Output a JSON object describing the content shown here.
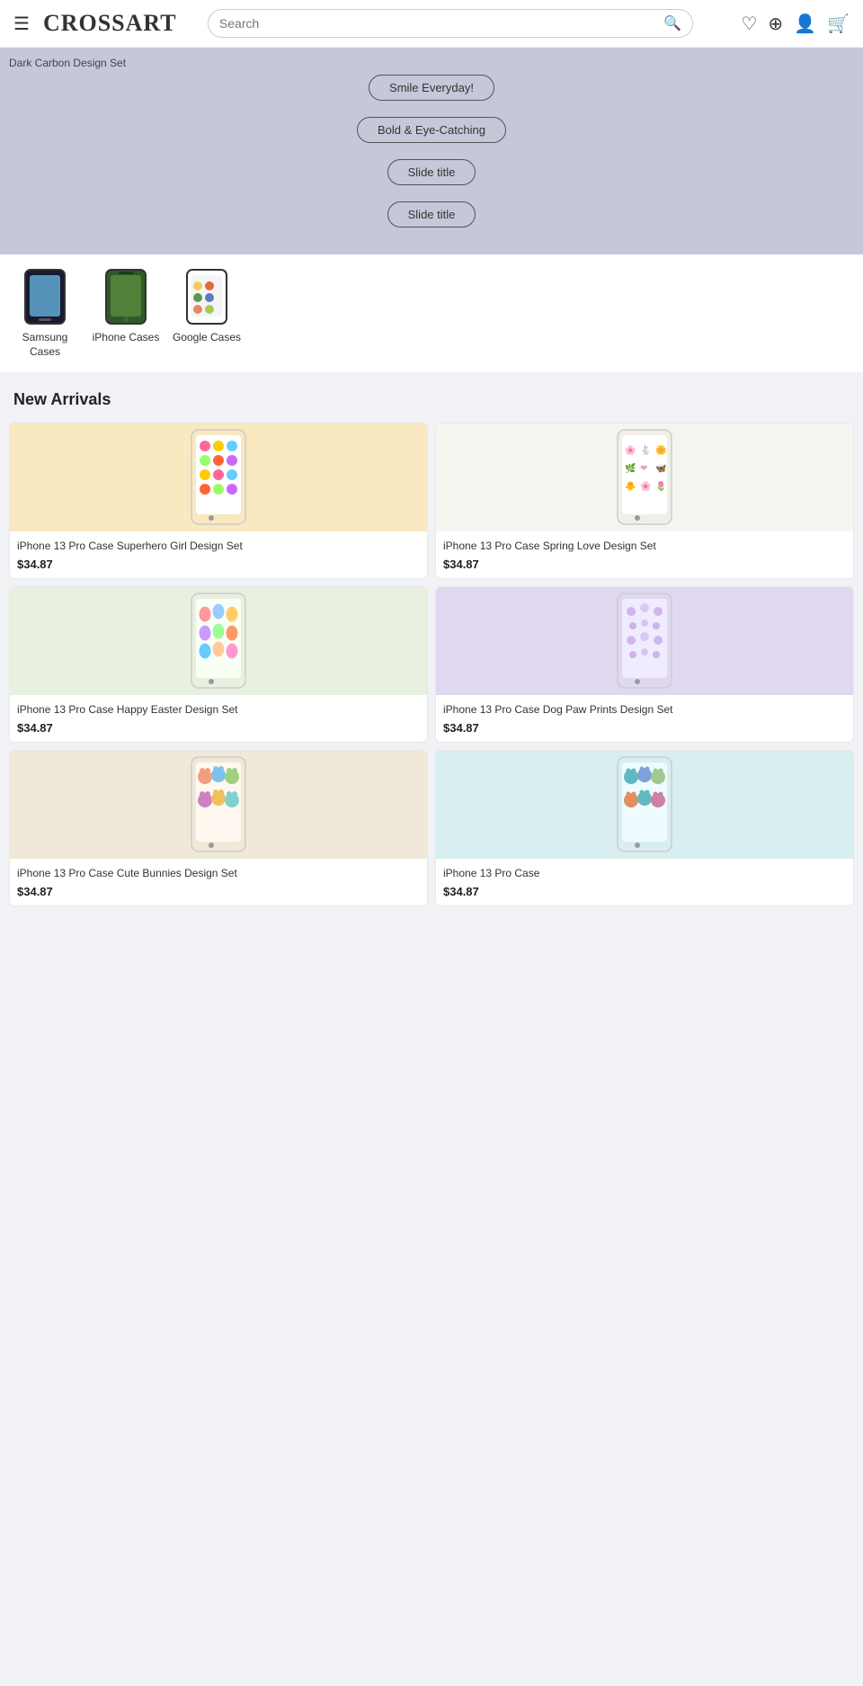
{
  "header": {
    "logo_text": "CROSSART",
    "search_placeholder": "Search",
    "menu_icon": "☰",
    "wishlist_icon": "♡",
    "compare_icon": "⊕",
    "account_icon": "👤",
    "cart_icon": "🛒"
  },
  "hero": {
    "label": "Dark Carbon Design Set",
    "badges": [
      "Smile Everyday!",
      "Bold & Eye-Catching",
      "Slide title",
      "Slide title"
    ]
  },
  "categories": [
    {
      "label": "Samsung Cases",
      "type": "samsung"
    },
    {
      "label": "iPhone Cases",
      "type": "iphone"
    },
    {
      "label": "Google Cases",
      "type": "google"
    }
  ],
  "new_arrivals": {
    "title": "New Arrivals",
    "products": [
      {
        "name": "iPhone 13 Pro Case Superhero Girl Design Set",
        "price": "$34.87",
        "bg": "#f9e8c0",
        "pattern": "superhero-girl"
      },
      {
        "name": "iPhone 13 Pro Case Spring Love Design Set",
        "price": "$34.87",
        "bg": "#f5f5f0",
        "pattern": "spring-love"
      },
      {
        "name": "iPhone 13 Pro Case Happy Easter Design Set",
        "price": "$34.87",
        "bg": "#e8f0e0",
        "pattern": "happy-easter"
      },
      {
        "name": "iPhone 13 Pro Case Dog Paw Prints Design Set",
        "price": "$34.87",
        "bg": "#e0d8f0",
        "pattern": "dog-paw"
      },
      {
        "name": "iPhone 13 Pro Case Cute Bunnies Design Set",
        "price": "$34.87",
        "bg": "#f0e8d8",
        "pattern": "cute-bunnies"
      },
      {
        "name": "iPhone 13 Pro Case",
        "price": "$34.87",
        "bg": "#d8eef0",
        "pattern": "teal-cats"
      }
    ]
  }
}
